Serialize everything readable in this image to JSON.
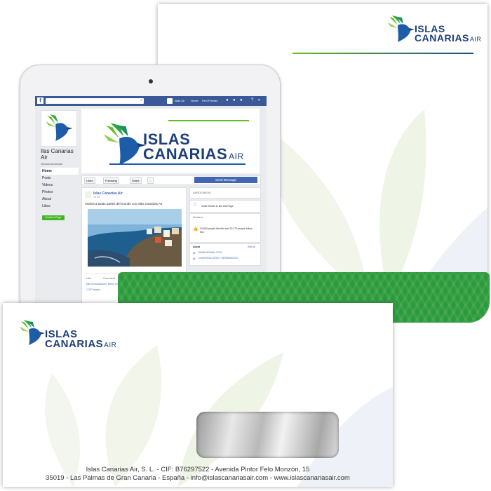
{
  "brand": {
    "name_line1": "ISLAS",
    "name_line2": "CANARIAS",
    "name_suffix": "AIR"
  },
  "facebook": {
    "search_icon": "search-icon",
    "nav": {
      "page_name": "Islas Air",
      "home": "Home",
      "find_friends": "Find Friends"
    },
    "page_title": "Ilas Canarias Air",
    "handle": "@islascanariasair",
    "sidebar": [
      "Home",
      "Posts",
      "Videos",
      "Photos",
      "About",
      "Likes"
    ],
    "create_page": "Create a Page",
    "actions": {
      "liked": "Liked",
      "following": "Following",
      "share": "Share",
      "more": "...",
      "send_message": "Send Message"
    },
    "post": {
      "author": "Islas Canarias Air",
      "time": "19 hrs",
      "text": "Vuelos a todas partes del mundo con Islas Canarias Air",
      "like": "Like",
      "comment": "Comment",
      "reactions": "Mkt Comunicación, Remy Cre",
      "shares": "1,327 shares"
    },
    "right": {
      "category": "AEROLÍNEAS",
      "invite": "Invite friends to like this Page",
      "community": "Similares",
      "likes": "20,803 people like this and 20,779 people follow this",
      "about": "About",
      "see_all": "See All",
      "website": "WWW.URKINA.COM",
      "service": "CONSTRUCCIÓN Y REPARACIÓN"
    }
  },
  "envelope": {
    "address_line1": "Islas Canarias Air, S. L. - CIF: B76297522 - Avenida Pintor Felo Monzón, 15",
    "address_line2": "35019 - Las Palmas de Gran Canaria - España - info@islascanariasair.com - www.islascanariasair.com"
  },
  "colors": {
    "brand_blue": "#1d3f78",
    "brand_green": "#66bb22",
    "envelope_flap": "#2b9a3a",
    "facebook_blue": "#3b5998"
  }
}
